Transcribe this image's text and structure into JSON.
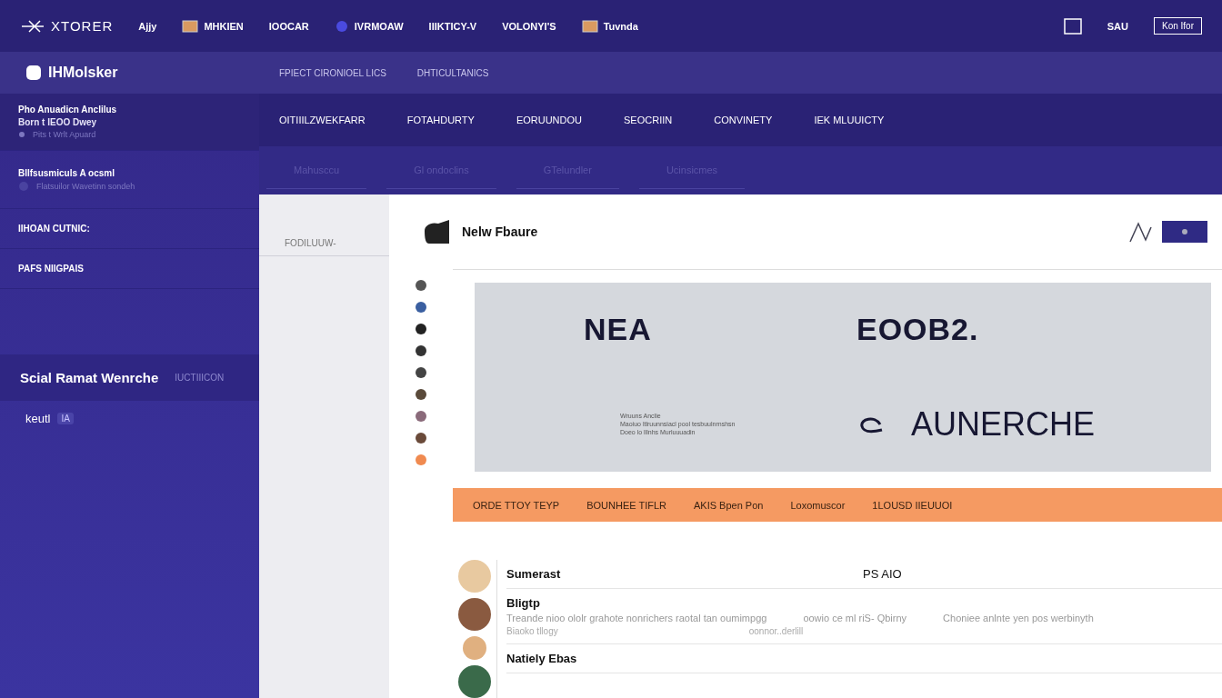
{
  "top_nav": {
    "brand": "XTORER",
    "items": [
      {
        "label": "Ajjy",
        "kind": "text"
      },
      {
        "label": "MHKIEN",
        "kind": "picture"
      },
      {
        "label": "IOOCAR",
        "kind": "text"
      },
      {
        "label": "IVRMOAW",
        "kind": "blob"
      },
      {
        "label": "IIIKTICY-V",
        "kind": "text"
      },
      {
        "label": "VOLONYI'S",
        "kind": "text"
      },
      {
        "label": "Tuvnda",
        "kind": "picture"
      }
    ],
    "right_label": "SAU",
    "button": "Kon Ifor"
  },
  "sub_bar": {
    "brand": "IHMolsker",
    "links": [
      "FPIECT CIRONIOEL LICS",
      "DHTICULTANICS"
    ]
  },
  "sidebar": {
    "sections": [
      {
        "title": "Pho Anuadicn Anclilus",
        "lines": [
          "Born t IEOO Dwey"
        ],
        "hint": "Pits t Wrlt Apuard"
      },
      {
        "title": "Bllfsusmiculs A ocsml",
        "hint": "Flatsuilor Wavetinn sondeh"
      },
      {
        "title": "IIHOAN CUTNIC:"
      },
      {
        "title": "PAFS NIIGPAIS"
      }
    ],
    "featured": {
      "title": "Scial Ramat Wenrche",
      "tag": "IUCTIIICON"
    },
    "footer_item": {
      "label": "keutl",
      "badge": "IA"
    }
  },
  "section_nav": [
    "OITIIILZWEKFARR",
    "FOTAHDURTY",
    "EORUUNDOU",
    "SEOCRIIN",
    "CONVINETY",
    "IEK MLUUICTY"
  ],
  "faint_tabs": [
    "Mahusccu",
    "Gl ondoclins",
    "GTelundler",
    "Ucinsicmes"
  ],
  "side_panel": {
    "label": "FODILUUW-"
  },
  "feature": {
    "title": "Nelw Fbaure",
    "banner": {
      "headline": "NEA",
      "headline_2": "EOOB2.",
      "caption_lines": [
        "Wruuns Anclie",
        "Maoiuo ltlruunnsiacl pool tesbuulnrnshsn",
        "Doeo lo lllnhs Murluuuadin"
      ],
      "title": "AUNERCHE"
    },
    "strip": [
      "ORDE TTOY TEYP",
      "BOUNHEE TIFLR",
      "AKIS Bpen Pon",
      "Loxomuscor",
      "1LOUSD IIEUUOI"
    ],
    "rows": [
      {
        "name": "Sumerast",
        "value": "PS AIO"
      },
      {
        "name": "Bligtp",
        "description": [
          "Treande nioo ololr grahote nonrichers raotal tan oumimpgg",
          "oowio ce ml riS- Qbirny",
          "Choniee anlnte yen pos werbinyth"
        ],
        "note": [
          "Biaoko tllogy",
          "oonnor..derlill"
        ]
      },
      {
        "name": "Natiely Ebas"
      }
    ]
  }
}
